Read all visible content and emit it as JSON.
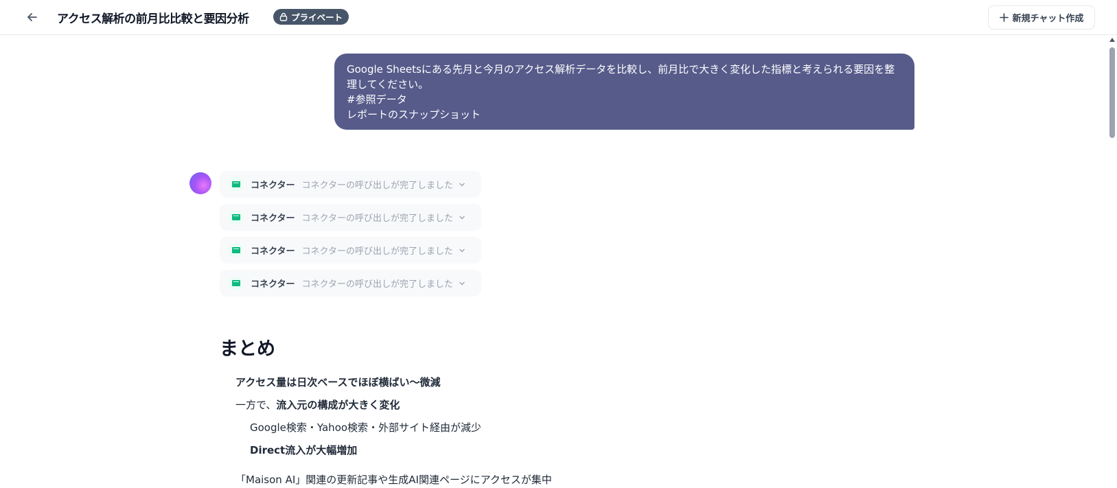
{
  "header": {
    "title": "アクセス解析の前月比比較と要因分析",
    "private_label": "プライベート",
    "new_chat_label": "新規チャット作成"
  },
  "user_message": {
    "lines": [
      "Google Sheetsにある先月と今月のアクセス解析データを比較し、前月比で大きく変化した指標と考えられる要因を整",
      "理してください。",
      "#参照データ",
      "レポートのスナップショット"
    ]
  },
  "connectors": [
    {
      "label": "コネクター",
      "status": "コネクターの呼び出しが完了しました"
    },
    {
      "label": "コネクター",
      "status": "コネクターの呼び出しが完了しました"
    },
    {
      "label": "コネクター",
      "status": "コネクターの呼び出しが完了しました"
    },
    {
      "label": "コネクター",
      "status": "コネクターの呼び出しが完了しました"
    }
  ],
  "summary": {
    "heading": "まとめ",
    "item1": "アクセス量は日次ベースでほぼ横ばい〜微減",
    "item2_prefix": "一方で、",
    "item2_bold": "流入元の構成が大きく変化",
    "sub1": "Google検索・Yahoo検索・外部サイト経由が減少",
    "sub2": "Direct流入が大幅増加",
    "item3": "「Maison AI」関連の更新記事や生成AI関連ページにアクセスが集中"
  },
  "colors": {
    "user_bubble": "#565b8a",
    "private_badge": "#475569",
    "connector_bg": "#f8f9fb",
    "sheet_icon": "#10b981"
  },
  "icons": [
    "back-arrow-icon",
    "lock-icon",
    "plus-icon",
    "sheets-icon",
    "chevron-down-icon",
    "assistant-avatar"
  ]
}
